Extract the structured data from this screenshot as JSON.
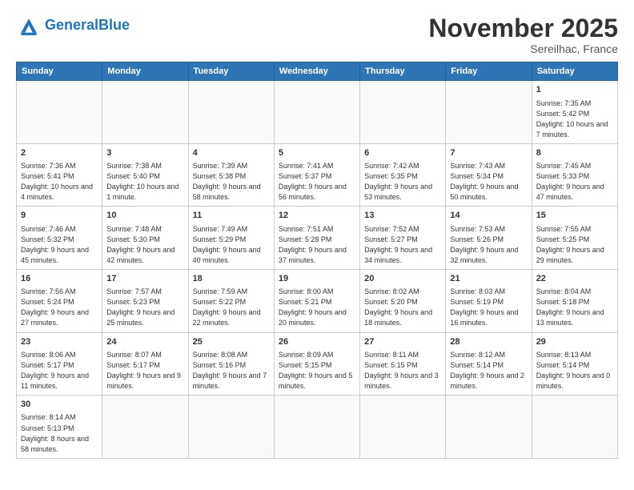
{
  "header": {
    "logo_general": "General",
    "logo_blue": "Blue",
    "month_title": "November 2025",
    "location": "Sereilhac, France"
  },
  "weekdays": [
    "Sunday",
    "Monday",
    "Tuesday",
    "Wednesday",
    "Thursday",
    "Friday",
    "Saturday"
  ],
  "days": [
    {
      "num": "",
      "info": ""
    },
    {
      "num": "",
      "info": ""
    },
    {
      "num": "",
      "info": ""
    },
    {
      "num": "",
      "info": ""
    },
    {
      "num": "",
      "info": ""
    },
    {
      "num": "",
      "info": ""
    },
    {
      "num": "1",
      "info": "Sunrise: 7:35 AM\nSunset: 5:42 PM\nDaylight: 10 hours and 7 minutes."
    },
    {
      "num": "2",
      "info": "Sunrise: 7:36 AM\nSunset: 5:41 PM\nDaylight: 10 hours and 4 minutes."
    },
    {
      "num": "3",
      "info": "Sunrise: 7:38 AM\nSunset: 5:40 PM\nDaylight: 10 hours and 1 minute."
    },
    {
      "num": "4",
      "info": "Sunrise: 7:39 AM\nSunset: 5:38 PM\nDaylight: 9 hours and 58 minutes."
    },
    {
      "num": "5",
      "info": "Sunrise: 7:41 AM\nSunset: 5:37 PM\nDaylight: 9 hours and 56 minutes."
    },
    {
      "num": "6",
      "info": "Sunrise: 7:42 AM\nSunset: 5:35 PM\nDaylight: 9 hours and 53 minutes."
    },
    {
      "num": "7",
      "info": "Sunrise: 7:43 AM\nSunset: 5:34 PM\nDaylight: 9 hours and 50 minutes."
    },
    {
      "num": "8",
      "info": "Sunrise: 7:45 AM\nSunset: 5:33 PM\nDaylight: 9 hours and 47 minutes."
    },
    {
      "num": "9",
      "info": "Sunrise: 7:46 AM\nSunset: 5:32 PM\nDaylight: 9 hours and 45 minutes."
    },
    {
      "num": "10",
      "info": "Sunrise: 7:48 AM\nSunset: 5:30 PM\nDaylight: 9 hours and 42 minutes."
    },
    {
      "num": "11",
      "info": "Sunrise: 7:49 AM\nSunset: 5:29 PM\nDaylight: 9 hours and 40 minutes."
    },
    {
      "num": "12",
      "info": "Sunrise: 7:51 AM\nSunset: 5:28 PM\nDaylight: 9 hours and 37 minutes."
    },
    {
      "num": "13",
      "info": "Sunrise: 7:52 AM\nSunset: 5:27 PM\nDaylight: 9 hours and 34 minutes."
    },
    {
      "num": "14",
      "info": "Sunrise: 7:53 AM\nSunset: 5:26 PM\nDaylight: 9 hours and 32 minutes."
    },
    {
      "num": "15",
      "info": "Sunrise: 7:55 AM\nSunset: 5:25 PM\nDaylight: 9 hours and 29 minutes."
    },
    {
      "num": "16",
      "info": "Sunrise: 7:56 AM\nSunset: 5:24 PM\nDaylight: 9 hours and 27 minutes."
    },
    {
      "num": "17",
      "info": "Sunrise: 7:57 AM\nSunset: 5:23 PM\nDaylight: 9 hours and 25 minutes."
    },
    {
      "num": "18",
      "info": "Sunrise: 7:59 AM\nSunset: 5:22 PM\nDaylight: 9 hours and 22 minutes."
    },
    {
      "num": "19",
      "info": "Sunrise: 8:00 AM\nSunset: 5:21 PM\nDaylight: 9 hours and 20 minutes."
    },
    {
      "num": "20",
      "info": "Sunrise: 8:02 AM\nSunset: 5:20 PM\nDaylight: 9 hours and 18 minutes."
    },
    {
      "num": "21",
      "info": "Sunrise: 8:03 AM\nSunset: 5:19 PM\nDaylight: 9 hours and 16 minutes."
    },
    {
      "num": "22",
      "info": "Sunrise: 8:04 AM\nSunset: 5:18 PM\nDaylight: 9 hours and 13 minutes."
    },
    {
      "num": "23",
      "info": "Sunrise: 8:06 AM\nSunset: 5:17 PM\nDaylight: 9 hours and 11 minutes."
    },
    {
      "num": "24",
      "info": "Sunrise: 8:07 AM\nSunset: 5:17 PM\nDaylight: 9 hours and 9 minutes."
    },
    {
      "num": "25",
      "info": "Sunrise: 8:08 AM\nSunset: 5:16 PM\nDaylight: 9 hours and 7 minutes."
    },
    {
      "num": "26",
      "info": "Sunrise: 8:09 AM\nSunset: 5:15 PM\nDaylight: 9 hours and 5 minutes."
    },
    {
      "num": "27",
      "info": "Sunrise: 8:11 AM\nSunset: 5:15 PM\nDaylight: 9 hours and 3 minutes."
    },
    {
      "num": "28",
      "info": "Sunrise: 8:12 AM\nSunset: 5:14 PM\nDaylight: 9 hours and 2 minutes."
    },
    {
      "num": "29",
      "info": "Sunrise: 8:13 AM\nSunset: 5:14 PM\nDaylight: 9 hours and 0 minutes."
    },
    {
      "num": "30",
      "info": "Sunrise: 8:14 AM\nSunset: 5:13 PM\nDaylight: 8 hours and 58 minutes."
    },
    {
      "num": "",
      "info": ""
    },
    {
      "num": "",
      "info": ""
    },
    {
      "num": "",
      "info": ""
    },
    {
      "num": "",
      "info": ""
    },
    {
      "num": "",
      "info": ""
    },
    {
      "num": "",
      "info": ""
    }
  ]
}
